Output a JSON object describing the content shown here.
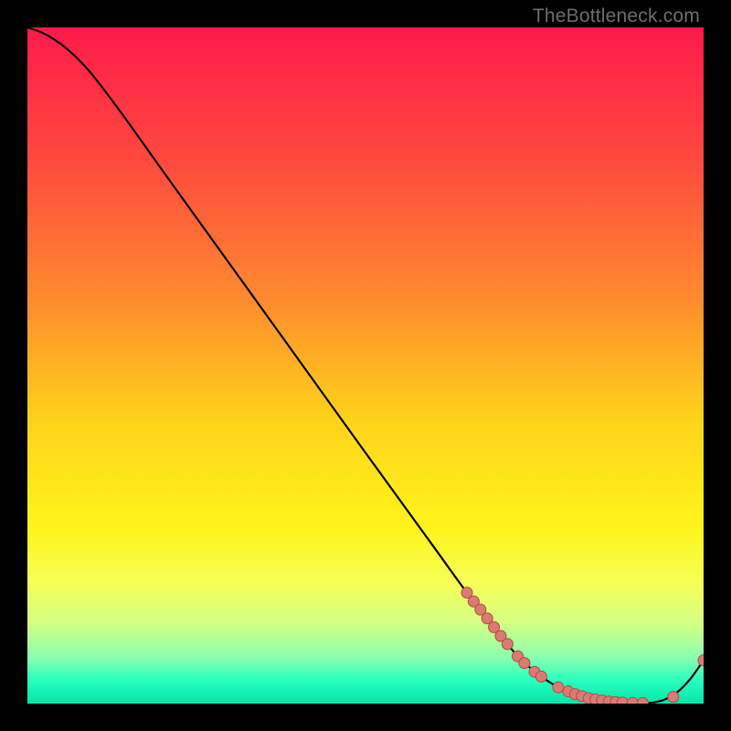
{
  "watermark": "TheBottleneck.com",
  "colors": {
    "bg": "#000000",
    "curve": "#000000",
    "marker_fill": "#db7a72",
    "marker_stroke": "#aa4f47"
  },
  "chart_data": {
    "type": "line",
    "title": "",
    "xlabel": "",
    "ylabel": "",
    "xlim": [
      0,
      100
    ],
    "ylim": [
      0,
      100
    ],
    "grid": false,
    "legend": false,
    "gradient_stops": [
      {
        "pos": 0.0,
        "color": "#ff1a4b"
      },
      {
        "pos": 0.2,
        "color": "#ff4a3e"
      },
      {
        "pos": 0.4,
        "color": "#ff8a2e"
      },
      {
        "pos": 0.58,
        "color": "#ffd21a"
      },
      {
        "pos": 0.74,
        "color": "#fff41a"
      },
      {
        "pos": 0.82,
        "color": "#f6ff55"
      },
      {
        "pos": 0.88,
        "color": "#d4ff82"
      },
      {
        "pos": 0.93,
        "color": "#8dffad"
      },
      {
        "pos": 0.965,
        "color": "#2bffbf"
      },
      {
        "pos": 1.0,
        "color": "#00e7a8"
      }
    ],
    "series": [
      {
        "name": "bottleneck-curve",
        "x": [
          0.0,
          2.0,
          4.0,
          6.0,
          8.0,
          10.0,
          14.0,
          20.0,
          30.0,
          40.0,
          50.0,
          60.0,
          65.0,
          70.0,
          72.0,
          74.0,
          76.0,
          78.0,
          80.0,
          82.0,
          84.0,
          86.0,
          88.0,
          90.0,
          92.0,
          94.0,
          96.0,
          98.0,
          100.0
        ],
        "y": [
          100.0,
          99.3,
          98.2,
          96.7,
          94.8,
          92.5,
          87.2,
          78.8,
          64.9,
          51.0,
          37.1,
          23.3,
          16.4,
          10.0,
          7.6,
          5.6,
          4.0,
          2.7,
          1.8,
          1.1,
          0.6,
          0.3,
          0.15,
          0.08,
          0.1,
          0.5,
          1.6,
          3.6,
          6.4
        ]
      }
    ],
    "markers": {
      "series": "bottleneck-curve",
      "points": [
        {
          "x": 65.0,
          "y": 16.4
        },
        {
          "x": 66.0,
          "y": 15.1
        },
        {
          "x": 67.0,
          "y": 13.9
        },
        {
          "x": 68.0,
          "y": 12.6
        },
        {
          "x": 69.0,
          "y": 11.3
        },
        {
          "x": 70.0,
          "y": 10.0
        },
        {
          "x": 71.0,
          "y": 8.8
        },
        {
          "x": 72.5,
          "y": 7.0
        },
        {
          "x": 73.5,
          "y": 6.0
        },
        {
          "x": 75.0,
          "y": 4.7
        },
        {
          "x": 76.0,
          "y": 4.0
        },
        {
          "x": 78.5,
          "y": 2.4
        },
        {
          "x": 80.0,
          "y": 1.8
        },
        {
          "x": 81.0,
          "y": 1.4
        },
        {
          "x": 82.0,
          "y": 1.1
        },
        {
          "x": 83.0,
          "y": 0.8
        },
        {
          "x": 84.0,
          "y": 0.6
        },
        {
          "x": 85.0,
          "y": 0.45
        },
        {
          "x": 86.0,
          "y": 0.3
        },
        {
          "x": 87.0,
          "y": 0.22
        },
        {
          "x": 88.0,
          "y": 0.15
        },
        {
          "x": 89.5,
          "y": 0.1
        },
        {
          "x": 91.0,
          "y": 0.08
        },
        {
          "x": 95.5,
          "y": 1.0
        },
        {
          "x": 100.0,
          "y": 6.4
        }
      ],
      "radius": 6
    }
  }
}
